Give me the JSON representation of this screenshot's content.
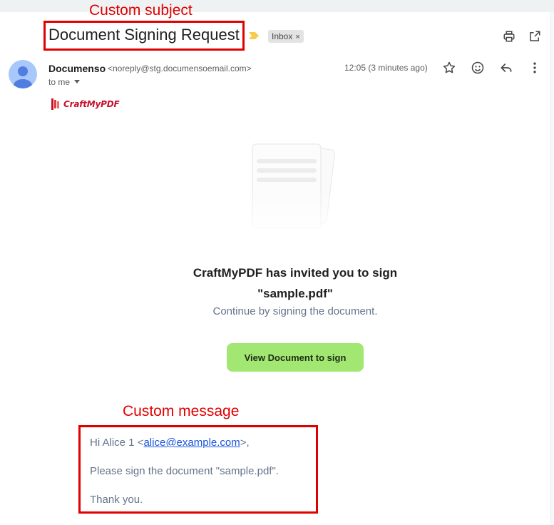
{
  "annotations": {
    "subject_label": "Custom subject",
    "message_label": "Custom message"
  },
  "email": {
    "subject": "Document Signing Request",
    "label_chip": "Inbox",
    "label_chip_close": "×",
    "sender": {
      "name": "Documenso",
      "address": "<noreply@stg.documensoemail.com>"
    },
    "recipient": "to me",
    "timestamp": "12:05 (3 minutes ago)"
  },
  "toolbar": {
    "icons": [
      "print-icon",
      "open-in-new-window-icon",
      "star-icon",
      "emoji-icon",
      "reply-icon",
      "more-vert-icon"
    ]
  },
  "body": {
    "logo_text": "CraftMyPDF",
    "headline_line1": "CraftMyPDF has invited you to sign",
    "headline_line2": "\"sample.pdf\"",
    "subline": "Continue by signing the document.",
    "cta_label": "View Document to sign",
    "message": {
      "greeting_prefix": "Hi Alice 1 <",
      "greeting_link": "alice@example.com",
      "greeting_suffix": ">,",
      "line2": "Please sign the document \"sample.pdf\".",
      "line3": "Thank you."
    }
  },
  "colors": {
    "annotation_red": "#e00000",
    "cta_green": "#a2e771",
    "link_blue": "#1a56db",
    "logo_red": "#c8102e",
    "label_arrow_yellow": "#f7cb4d",
    "avatar_blue": "#a8c7fa"
  }
}
